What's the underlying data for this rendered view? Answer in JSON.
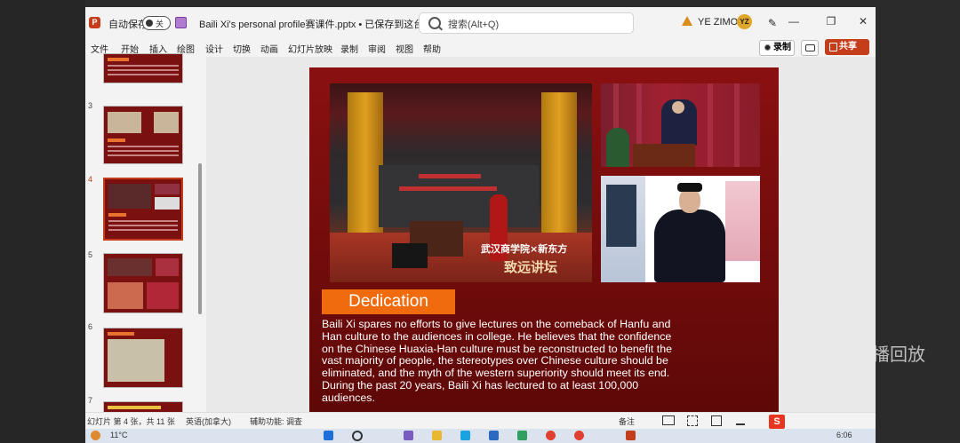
{
  "window": {
    "autosave_label": "自动保存",
    "autosave_state": "关",
    "filename": "Baili Xi's personal profile赛课件.pptx • 已保存到这台电脑 ⌄",
    "search_placeholder": "搜索(Alt+Q)",
    "username": "YE ZIMO",
    "avatar_initials": "YZ",
    "minimize": "—",
    "maximize": "❐",
    "close": "✕"
  },
  "ribbon": {
    "tabs": [
      "文件",
      "开始",
      "插入",
      "绘图",
      "设计",
      "切换",
      "动画",
      "幻灯片放映",
      "录制",
      "审阅",
      "视图",
      "帮助"
    ],
    "record_label": "录制",
    "share_label": "共享"
  },
  "thumbnails": [
    {
      "num": "",
      "active": false
    },
    {
      "num": "3",
      "active": false
    },
    {
      "num": "4",
      "active": true
    },
    {
      "num": "5",
      "active": false
    },
    {
      "num": "6",
      "active": false
    },
    {
      "num": "7",
      "active": false
    }
  ],
  "slide": {
    "caption_line1": "武汉商学院×新东方",
    "caption_line2": "致远讲坛",
    "dedication_title": "Dedication",
    "body_lines": [
      "Baili Xi spares no efforts to give lectures on the comeback of Hanfu and",
      "Han culture to the audiences in college. He believes that the confidence",
      "on the Chinese Huaxia-Han culture must be reconstructed to benefit the",
      "vast majority of people, the stereotypes over Chinese culture should be",
      "eliminated, and the myth of the western superiority should meet its end.",
      "During the past 20 years, Baili Xi has lectured to at least 100,000",
      "audiences."
    ]
  },
  "statusbar": {
    "slide_count": "幻灯片 第 4 张，共 11 张",
    "language": "英语(加拿大)",
    "accessibility": "辅助功能: 调查",
    "notes": "备注"
  },
  "taskbar": {
    "weather": "11°C",
    "time": "6:06"
  },
  "overlay": {
    "replay_label": "直播回放"
  },
  "colors": {
    "accent": "#c43e1c",
    "slide_bg": "#7a0d0d",
    "dedication_orange": "#f06b0e"
  }
}
